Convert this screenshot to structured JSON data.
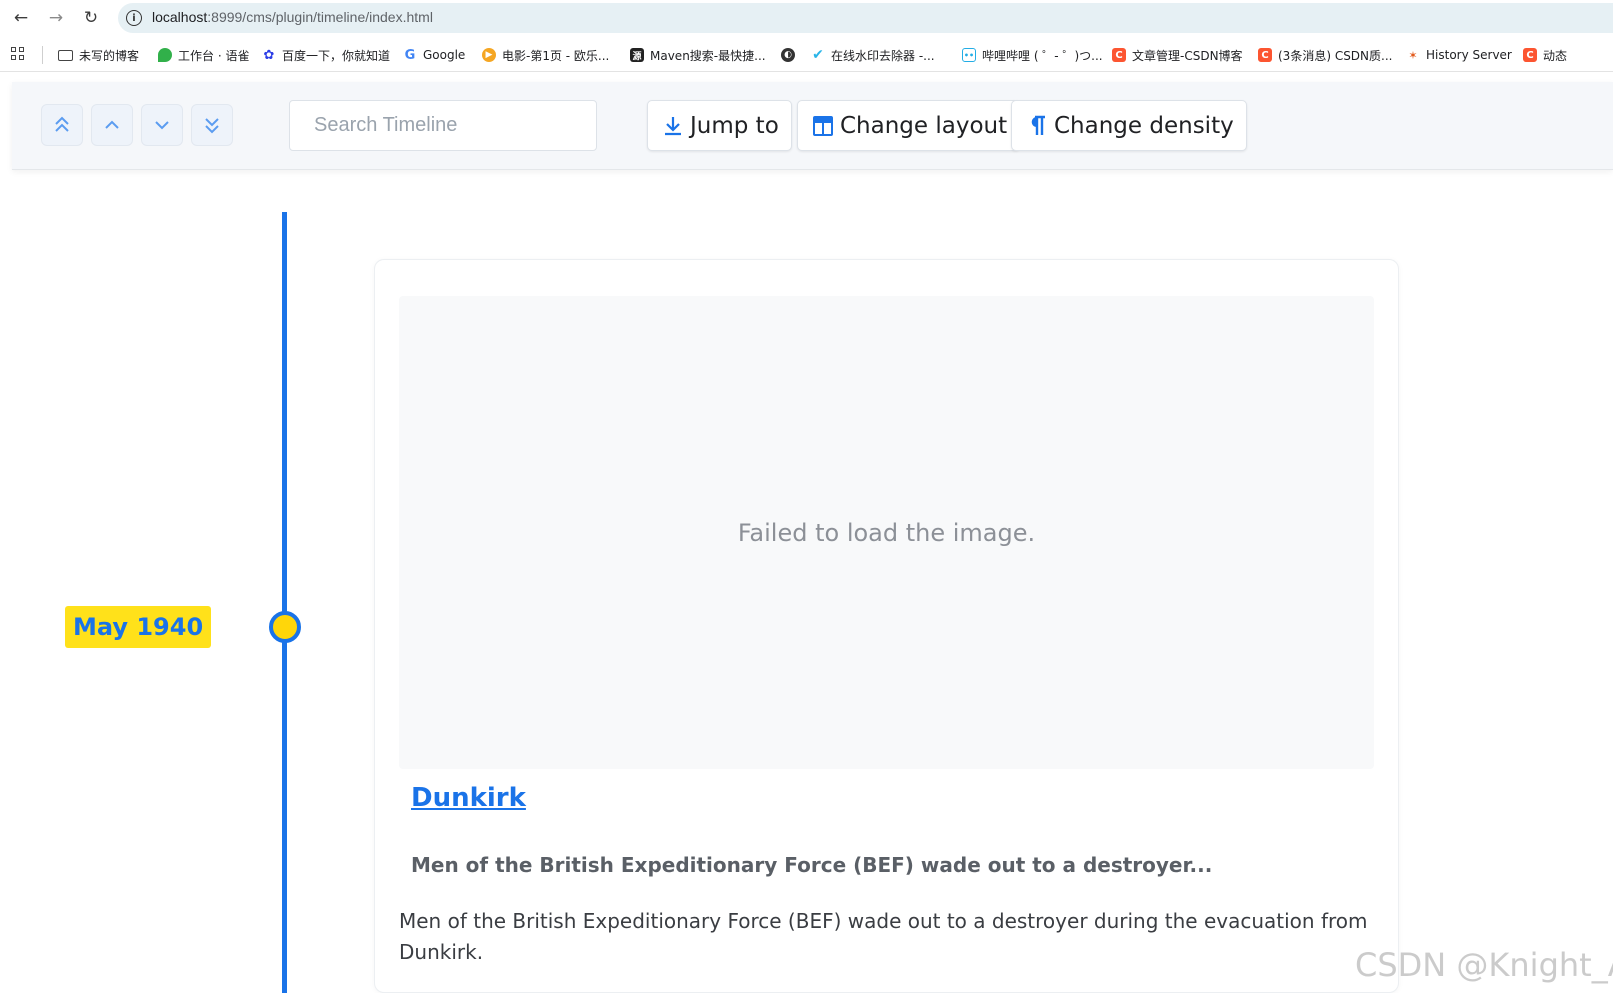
{
  "browser": {
    "url_host": "localhost",
    "url_path": ":8999/cms/plugin/timeline/index.html"
  },
  "bookmarks": [
    {
      "label": "未写的博客",
      "icon": "folder-icon",
      "color": "#444444"
    },
    {
      "label": "工作台 · 语雀",
      "icon": "yuque-icon",
      "color": "#31b04a"
    },
    {
      "label": "百度一下，你就知道",
      "icon": "baidu-icon",
      "color": "#2b3de6"
    },
    {
      "label": "Google",
      "icon": "google-icon",
      "color": "#4285f4"
    },
    {
      "label": "电影-第1页 - 欧乐...",
      "icon": "movie-icon",
      "color": "#f5a623"
    },
    {
      "label": "Maven搜索-最快捷...",
      "icon": "maven-icon",
      "color": "#222222"
    },
    {
      "label": "",
      "icon": "globe-icon",
      "color": "#333333"
    },
    {
      "label": "在线水印去除器 -...",
      "icon": "watermark-remover-icon",
      "color": "#2ab5e8"
    },
    {
      "label": "哔哩哔哩 ( ゜- ゜)つ...",
      "icon": "bilibili-icon",
      "color": "#23ade5"
    },
    {
      "label": "文章管理-CSDN博客",
      "icon": "csdn-icon",
      "color": "#fc5531"
    },
    {
      "label": "(3条消息) CSDN质...",
      "icon": "csdn-icon",
      "color": "#fc5531"
    },
    {
      "label": "History Server",
      "icon": "spark-icon",
      "color": "#e25a1c"
    },
    {
      "label": "动态",
      "icon": "csdn-icon",
      "color": "#fc5531"
    }
  ],
  "toolbar": {
    "search_placeholder": "Search Timeline",
    "jump_label": "Jump to",
    "layout_label": "Change layout",
    "density_label": "Change density",
    "accent": "#1a73e8"
  },
  "timeline": {
    "date": "May 1940",
    "card": {
      "image_error": "Failed to load the image.",
      "title": "Dunkirk",
      "subtitle": "Men of the British Expeditionary Force (BEF) wade out to a destroyer...",
      "body": "Men of the British Expeditionary Force (BEF) wade out to a destroyer during the evacuation from Dunkirk."
    }
  },
  "watermark": "CSDN @Knight_AL"
}
